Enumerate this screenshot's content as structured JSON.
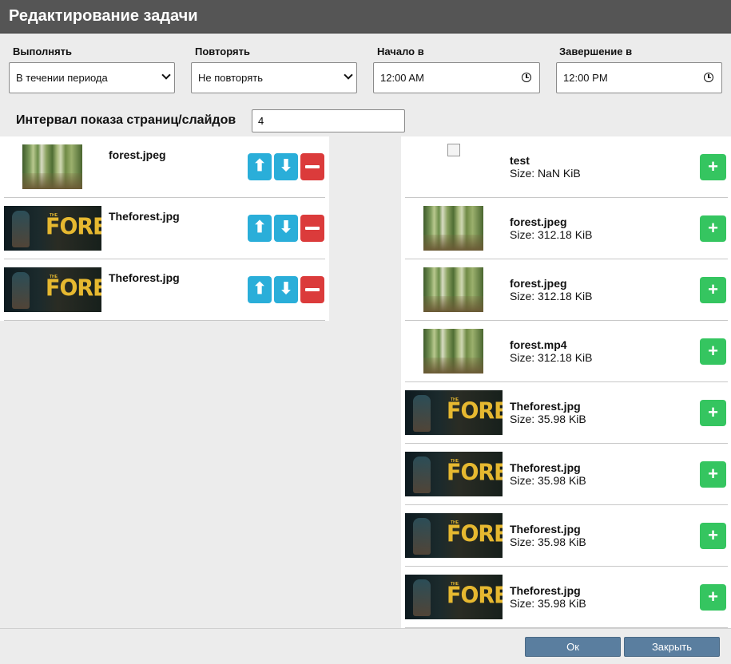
{
  "dialog": {
    "title": "Редактирование задачи"
  },
  "fields": {
    "execute": {
      "label": "Выполнять",
      "value": "В течении периода"
    },
    "repeat": {
      "label": "Повторять",
      "value": "Не повторять"
    },
    "start": {
      "label": "Начало в",
      "value": "12:00 AM"
    },
    "end": {
      "label": "Завершение в",
      "value": "12:00 PM"
    },
    "interval": {
      "label": "Интервал показа страниц/слайдов",
      "value": "4"
    }
  },
  "selected": [
    {
      "name": "forest.jpeg",
      "thumb": "forest"
    },
    {
      "name": "Theforest.jpg",
      "thumb": "game"
    },
    {
      "name": "Theforest.jpg",
      "thumb": "game"
    }
  ],
  "library": [
    {
      "name": "test",
      "size": "Size: NaN KiB",
      "thumb": "broken"
    },
    {
      "name": "forest.jpeg",
      "size": "Size: 312.18 KiB",
      "thumb": "forest"
    },
    {
      "name": "forest.jpeg",
      "size": "Size: 312.18 KiB",
      "thumb": "forest"
    },
    {
      "name": "forest.mp4",
      "size": "Size: 312.18 KiB",
      "thumb": "forest"
    },
    {
      "name": "Theforest.jpg",
      "size": "Size: 35.98 KiB",
      "thumb": "game"
    },
    {
      "name": "Theforest.jpg",
      "size": "Size: 35.98 KiB",
      "thumb": "game"
    },
    {
      "name": "Theforest.jpg",
      "size": "Size: 35.98 KiB",
      "thumb": "game"
    },
    {
      "name": "Theforest.jpg",
      "size": "Size: 35.98 KiB",
      "thumb": "game"
    }
  ],
  "icons": {
    "up": "⬆",
    "down": "⬇",
    "add": "+",
    "logo_the": "THE",
    "logo_text": "FOREST"
  },
  "footer": {
    "ok_label": "Ок",
    "close_label": "Закрыть"
  }
}
